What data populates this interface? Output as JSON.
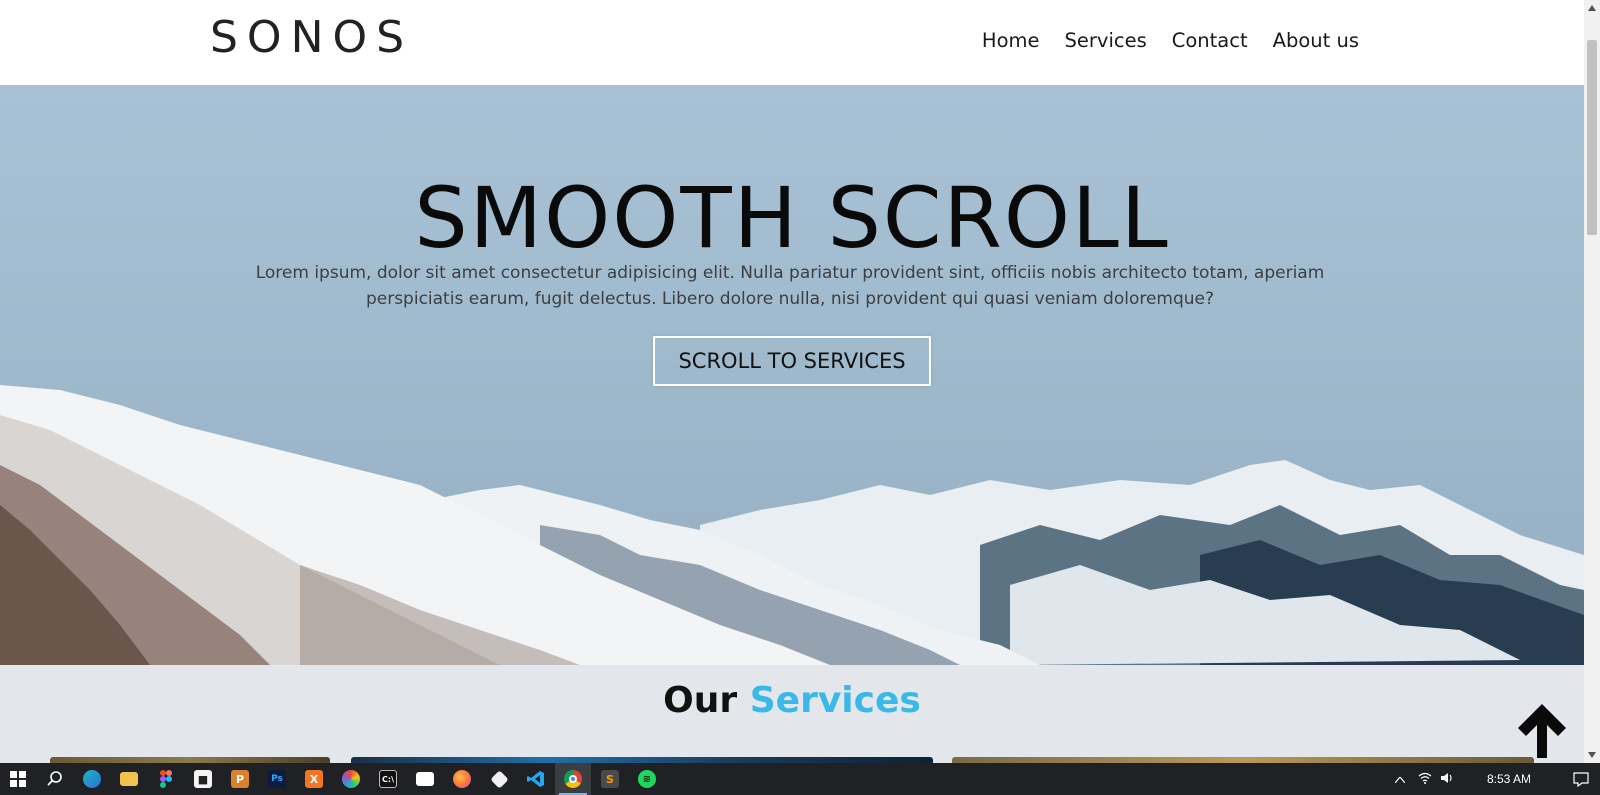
{
  "header": {
    "logo": "SONOS",
    "nav": [
      "Home",
      "Services",
      "Contact",
      "About us"
    ]
  },
  "hero": {
    "title": "SMOOTH SCROLL",
    "text_line1": "Lorem ipsum, dolor sit amet consectetur adipisicing elit. Nulla pariatur provident sint, officiis nobis architecto totam, aperiam",
    "text_line2": "perspiciatis earum, fugit delectus. Libero dolore nulla, nisi provident qui quasi veniam doloremque?",
    "button": "SCROLL TO SERVICES"
  },
  "services": {
    "title_main": "Our",
    "title_accent": "Services",
    "accent_color": "#3ab8e8"
  },
  "taskbar": {
    "icons": [
      "windows-start-icon",
      "search-icon",
      "edge-icon",
      "file-explorer-icon",
      "figma-icon",
      "camera-icon",
      "powerpoint-icon",
      "photoshop-icon",
      "xampp-icon",
      "color-picker-icon",
      "terminal-icon",
      "store-icon",
      "firefox-icon",
      "git-icon",
      "vscode-icon",
      "chrome-icon",
      "sublime-icon",
      "spotify-icon"
    ],
    "time": "8:53 AM"
  }
}
